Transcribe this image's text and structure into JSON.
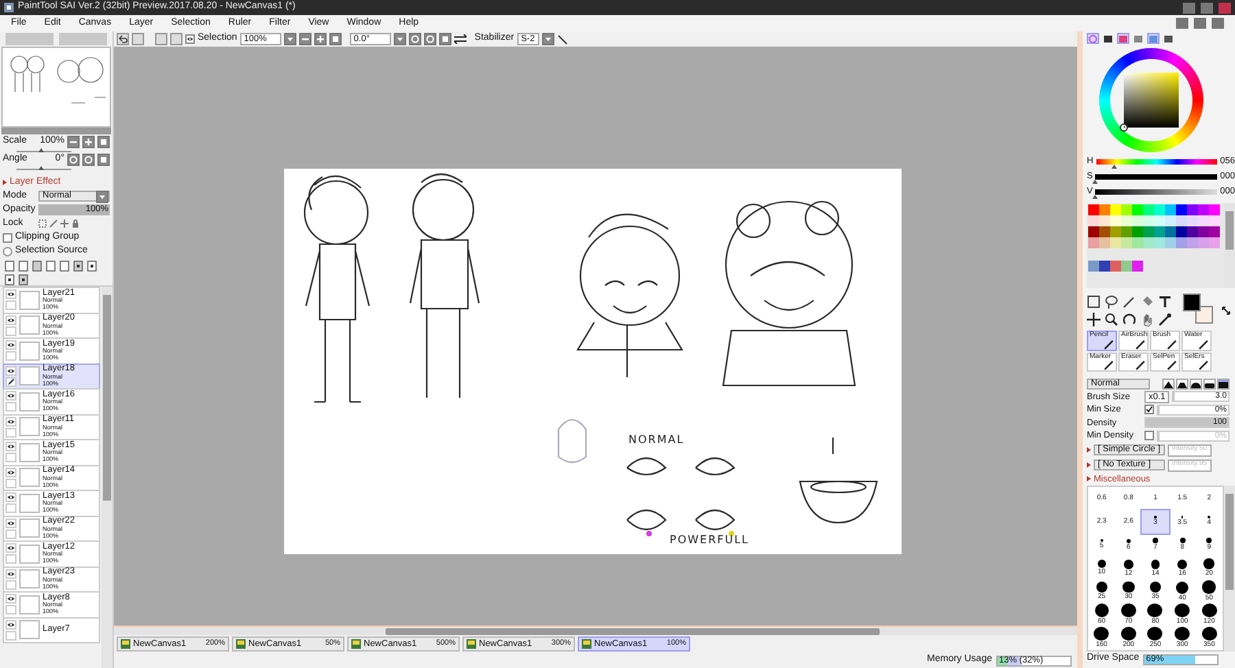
{
  "window": {
    "title": "PaintTool SAI Ver.2 (32bit) Preview.2017.08.20 - NewCanvas1 (*)"
  },
  "menu": [
    "File",
    "Edit",
    "Canvas",
    "Layer",
    "Selection",
    "Ruler",
    "Filter",
    "View",
    "Window",
    "Help"
  ],
  "toolbar": {
    "selection_label": "Selection",
    "selection_on": true,
    "zoom": "100%",
    "angle": "0.0°",
    "stabilizer_label": "Stabilizer",
    "stabilizer": "S-2"
  },
  "navigator": {
    "scale_label": "Scale",
    "scale": "100%",
    "scale_slider": {
      "level": 0.45
    },
    "angle_label": "Angle",
    "angle": "0°",
    "angle_slider": {
      "level": 0.45
    }
  },
  "layer_effect": {
    "label": "Layer Effect"
  },
  "layer_props": {
    "mode_label": "Mode",
    "mode": "Normal",
    "opacity_label": "Opacity",
    "opacity": "100%",
    "level": 1,
    "lock_label": "Lock",
    "clipping_label": "Clipping Group",
    "clipping_checked": false,
    "source_label": "Selection Source",
    "source_checked": false
  },
  "layers": [
    {
      "name": "Layer21",
      "mode": "Normal",
      "opacity": "100%",
      "visible": true,
      "selected": false
    },
    {
      "name": "Layer20",
      "mode": "Normal",
      "opacity": "100%",
      "visible": true,
      "selected": false
    },
    {
      "name": "Layer19",
      "mode": "Normal",
      "opacity": "100%",
      "visible": true,
      "selected": false
    },
    {
      "name": "Layer18",
      "mode": "Normal",
      "opacity": "100%",
      "visible": true,
      "selected": true
    },
    {
      "name": "Layer16",
      "mode": "Normal",
      "opacity": "100%",
      "visible": true,
      "selected": false
    },
    {
      "name": "Layer11",
      "mode": "Normal",
      "opacity": "100%",
      "visible": true,
      "selected": false
    },
    {
      "name": "Layer15",
      "mode": "Normal",
      "opacity": "100%",
      "visible": true,
      "selected": false
    },
    {
      "name": "Layer14",
      "mode": "Normal",
      "opacity": "100%",
      "visible": true,
      "selected": false
    },
    {
      "name": "Layer13",
      "mode": "Normal",
      "opacity": "100%",
      "visible": true,
      "selected": false
    },
    {
      "name": "Layer22",
      "mode": "Normal",
      "opacity": "100%",
      "visible": true,
      "selected": false
    },
    {
      "name": "Layer12",
      "mode": "Normal",
      "opacity": "100%",
      "visible": true,
      "selected": false
    },
    {
      "name": "Layer23",
      "mode": "Normal",
      "opacity": "100%",
      "visible": true,
      "selected": false
    },
    {
      "name": "Layer8",
      "mode": "Normal",
      "opacity": "100%",
      "visible": true,
      "selected": false
    },
    {
      "name": "Layer7",
      "visible": true,
      "selected": false
    }
  ],
  "canvas": {
    "labels": [
      "NORMAL",
      "POWERFULL"
    ]
  },
  "tabs": [
    {
      "label": "NewCanvas1",
      "zoom": "200%",
      "selected": false
    },
    {
      "label": "NewCanvas1",
      "zoom": "50%",
      "selected": false
    },
    {
      "label": "NewCanvas1",
      "zoom": "500%",
      "selected": false
    },
    {
      "label": "NewCanvas1",
      "zoom": "300%",
      "selected": false
    },
    {
      "label": "NewCanvas1",
      "zoom": "100%",
      "selected": true
    }
  ],
  "color_tabs": [
    {
      "selected": true
    },
    {
      "selected": false
    },
    {
      "selected": true
    },
    {
      "selected": false
    },
    {
      "selected": true
    },
    {
      "selected": false
    }
  ],
  "color": {
    "h_label": "H",
    "h": "056",
    "s_label": "S",
    "s": "000",
    "v_label": "V",
    "v": "000"
  },
  "swatches": [
    [
      {
        "color": "#ff0000"
      },
      {
        "color": "#ff8000"
      },
      {
        "color": "#ffff00"
      },
      {
        "color": "#a0ff00"
      },
      {
        "color": "#00ff00"
      },
      {
        "color": "#00ff80"
      },
      {
        "color": "#00ffd0"
      },
      {
        "color": "#00c0ff"
      },
      {
        "color": "#0000ff"
      },
      {
        "color": "#8000ff"
      },
      {
        "color": "#c000ff"
      },
      {
        "color": "#ff00ff"
      }
    ],
    [
      {
        "color": "#ffd8d8"
      },
      {
        "color": "#ffe8d0"
      },
      {
        "color": "#ffffd0"
      },
      {
        "color": "#eaffd0"
      },
      {
        "color": "#d8ffd8"
      },
      {
        "color": "#d0ffe8"
      },
      {
        "color": "#d0fff8"
      },
      {
        "color": "#d0f0ff"
      },
      {
        "color": "#d8d8ff"
      },
      {
        "color": "#e8d8ff"
      },
      {
        "color": "#f4d8ff"
      },
      {
        "color": "#ffd8ff"
      }
    ],
    [
      {
        "color": "#a00000"
      },
      {
        "color": "#a05000"
      },
      {
        "color": "#a0a000"
      },
      {
        "color": "#60a000"
      },
      {
        "color": "#00a000"
      },
      {
        "color": "#00a050"
      },
      {
        "color": "#00a090"
      },
      {
        "color": "#0070a0"
      },
      {
        "color": "#0000a0"
      },
      {
        "color": "#5000a0"
      },
      {
        "color": "#8000a0"
      },
      {
        "color": "#a000a0"
      }
    ],
    [
      {
        "color": "#e8a0a0"
      },
      {
        "color": "#e8c0a0"
      },
      {
        "color": "#e8e8a0"
      },
      {
        "color": "#c8e8a0"
      },
      {
        "color": "#a0e8a0"
      },
      {
        "color": "#a0e8c8"
      },
      {
        "color": "#a0e8e0"
      },
      {
        "color": "#a0d0e8"
      },
      {
        "color": "#a0a0e8"
      },
      {
        "color": "#c0a0e8"
      },
      {
        "color": "#d8a0e8"
      },
      {
        "color": "#e8a0e8"
      }
    ],
    [
      {
        "color": "#7a9ac8"
      },
      {
        "color": "#3040b0"
      },
      {
        "color": "#e06060"
      },
      {
        "color": "#90c890"
      },
      {
        "color": "#e020f0"
      }
    ]
  ],
  "current_colors": [
    {
      "color": "#000000"
    },
    {
      "color": "#fdeee4"
    }
  ],
  "tools": [
    {
      "label": "Pencil",
      "selected": true
    },
    {
      "label": "AirBrush",
      "selected": false
    },
    {
      "label": "Brush",
      "selected": false
    },
    {
      "label": "Water",
      "selected": false
    },
    {
      "label": "Marker",
      "selected": false
    },
    {
      "label": "Eraser",
      "selected": false
    },
    {
      "label": "SelPen",
      "selected": false
    },
    {
      "label": "SelErs",
      "selected": false
    }
  ],
  "brush": {
    "mode": "Normal",
    "shapes": [
      {
        "selected": false
      },
      {
        "selected": false
      },
      {
        "selected": false
      },
      {
        "selected": false
      },
      {
        "selected": true
      }
    ],
    "size_label": "Brush Size",
    "size_mult": "x0.1",
    "size": "3.0",
    "size_slider": {
      "level": 0
    },
    "min_size_label": "Min Size",
    "min_size_checked": true,
    "min_size": "0%",
    "min_size_slider": {
      "level": 0
    },
    "density_label": "Density",
    "density": "100",
    "density_slider": {
      "level": 1
    },
    "min_density_label": "Min Density",
    "min_density_checked": false,
    "min_density": "0%",
    "min_density_slider": {
      "level": 0
    },
    "shape": "[ Simple Circle ]",
    "shape_intensity": "Intensity 50",
    "texture": "[ No Texture ]",
    "texture_intensity": "Intensity 95",
    "misc_label": "Miscellaneous"
  },
  "brush_sizes": [
    {
      "label": "0.6",
      "selected": false
    },
    {
      "label": "0.8",
      "selected": false
    },
    {
      "label": "1",
      "selected": false
    },
    {
      "label": "1.5",
      "selected": false
    },
    {
      "label": "2",
      "selected": false
    },
    {
      "label": "2.3",
      "selected": false
    },
    {
      "label": "2.6",
      "selected": false
    },
    {
      "label": "3",
      "selected": true
    },
    {
      "label": "3.5",
      "selected": false
    },
    {
      "label": "4",
      "selected": false
    },
    {
      "label": "5",
      "selected": false
    },
    {
      "label": "6",
      "selected": false
    },
    {
      "label": "7",
      "selected": false
    },
    {
      "label": "8",
      "selected": false
    },
    {
      "label": "9",
      "selected": false
    },
    {
      "label": "10",
      "selected": false
    },
    {
      "label": "12",
      "selected": false
    },
    {
      "label": "14",
      "selected": false
    },
    {
      "label": "16",
      "selected": false
    },
    {
      "label": "20",
      "selected": false
    },
    {
      "label": "25",
      "selected": false
    },
    {
      "label": "30",
      "selected": false
    },
    {
      "label": "35",
      "selected": false
    },
    {
      "label": "40",
      "selected": false
    },
    {
      "label": "50",
      "selected": false
    },
    {
      "label": "60",
      "selected": false
    },
    {
      "label": "70",
      "selected": false
    },
    {
      "label": "80",
      "selected": false
    },
    {
      "label": "100",
      "selected": false
    },
    {
      "label": "120",
      "selected": false
    },
    {
      "label": "160",
      "selected": false
    },
    {
      "label": "200",
      "selected": false
    },
    {
      "label": "250",
      "selected": false
    },
    {
      "label": "300",
      "selected": false
    },
    {
      "label": "350",
      "selected": false
    }
  ],
  "status": {
    "memory_label": "Memory Usage",
    "memory": {
      "text": "13% (32%)",
      "level": 0.13
    },
    "memory_peak": {
      "level": 0.32
    },
    "drive_label": "Drive Space",
    "drive": {
      "text": "69%",
      "level": 0.69
    }
  }
}
